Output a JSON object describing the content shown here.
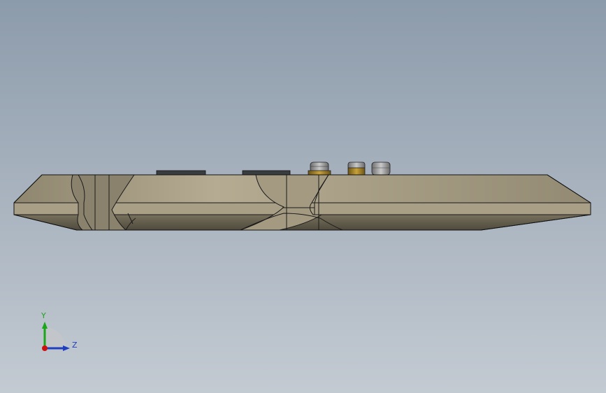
{
  "viewport": {
    "background_top": "#8c9bab",
    "background_bottom": "#c3cad2"
  },
  "model": {
    "body_color": "#a99e86",
    "body_light": "#b4aa91",
    "body_dark": "#6f6753",
    "edge_color": "#1a1a1a",
    "connector_metal": "#8f8f8f",
    "connector_gold": "#9c7a22"
  },
  "triad": {
    "y_label": "Y",
    "z_label": "Z",
    "y_color": "#1aa51a",
    "z_color": "#1f3fbf",
    "x_color": "#cc1111",
    "y_icon": "y-axis-arrow-icon",
    "z_icon": "z-axis-arrow-icon",
    "x_icon": "x-axis-origin-icon"
  }
}
